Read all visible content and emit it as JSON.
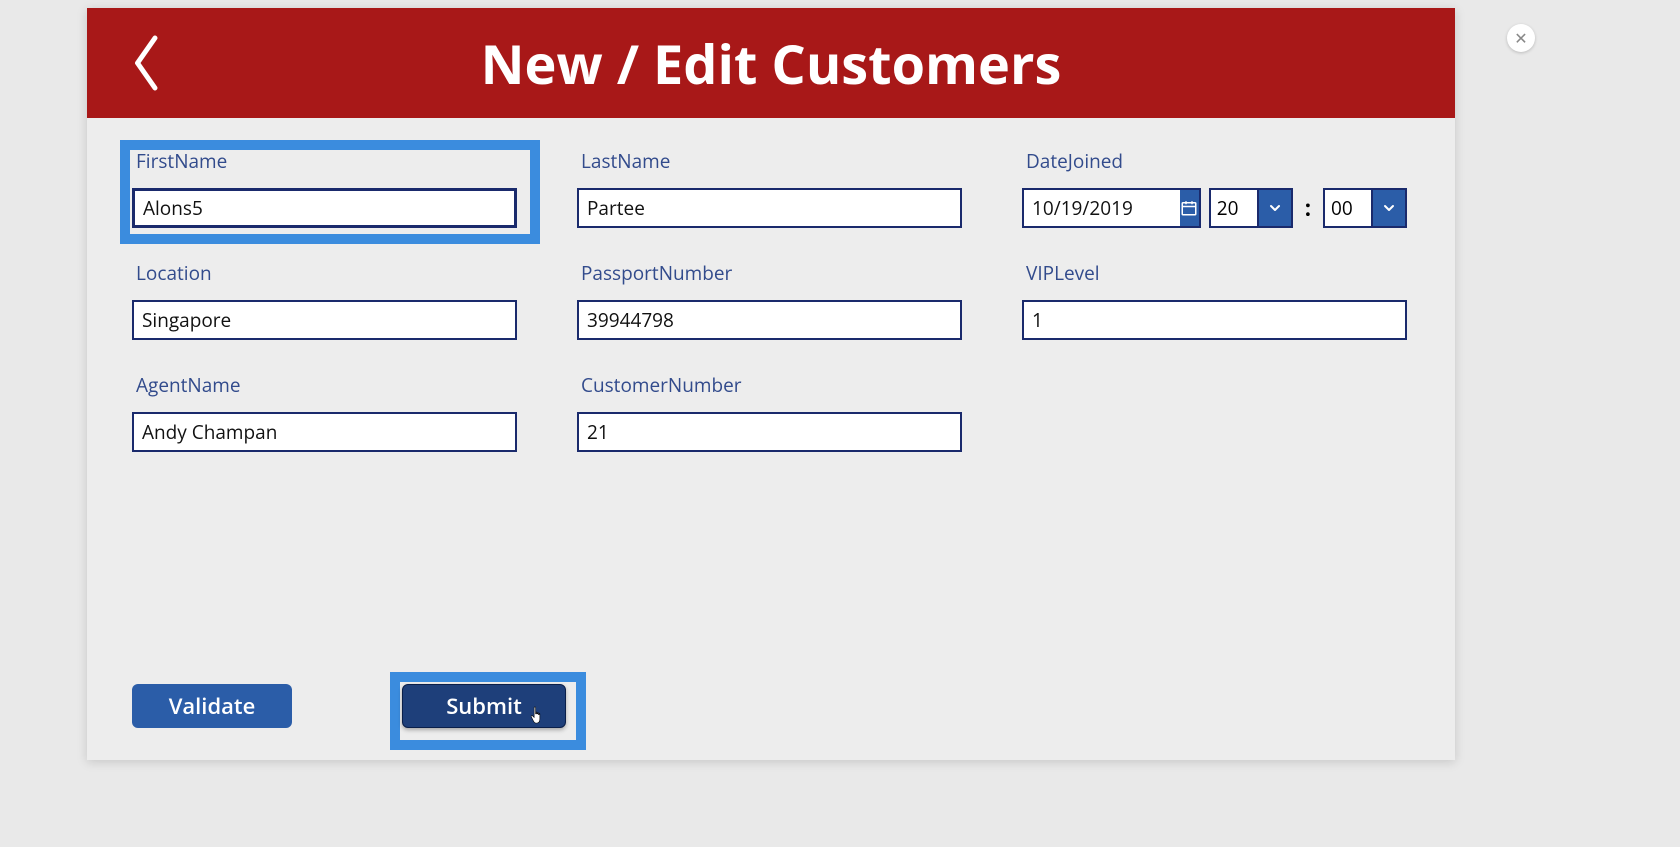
{
  "header": {
    "title": "New / Edit Customers"
  },
  "fields": {
    "firstName": {
      "label": "FirstName",
      "value": "Alons5"
    },
    "lastName": {
      "label": "LastName",
      "value": "Partee"
    },
    "dateJoined": {
      "label": "DateJoined",
      "date": "10/19/2019",
      "hour": "20",
      "minute": "00",
      "sep": ":"
    },
    "location": {
      "label": "Location",
      "value": "Singapore"
    },
    "passportNumber": {
      "label": "PassportNumber",
      "value": "39944798"
    },
    "vipLevel": {
      "label": "VIPLevel",
      "value": "1"
    },
    "agentName": {
      "label": "AgentName",
      "value": "Andy Champan"
    },
    "customerNumber": {
      "label": "CustomerNumber",
      "value": "21"
    }
  },
  "buttons": {
    "validate": "Validate",
    "submit": "Submit"
  },
  "close": "✕"
}
